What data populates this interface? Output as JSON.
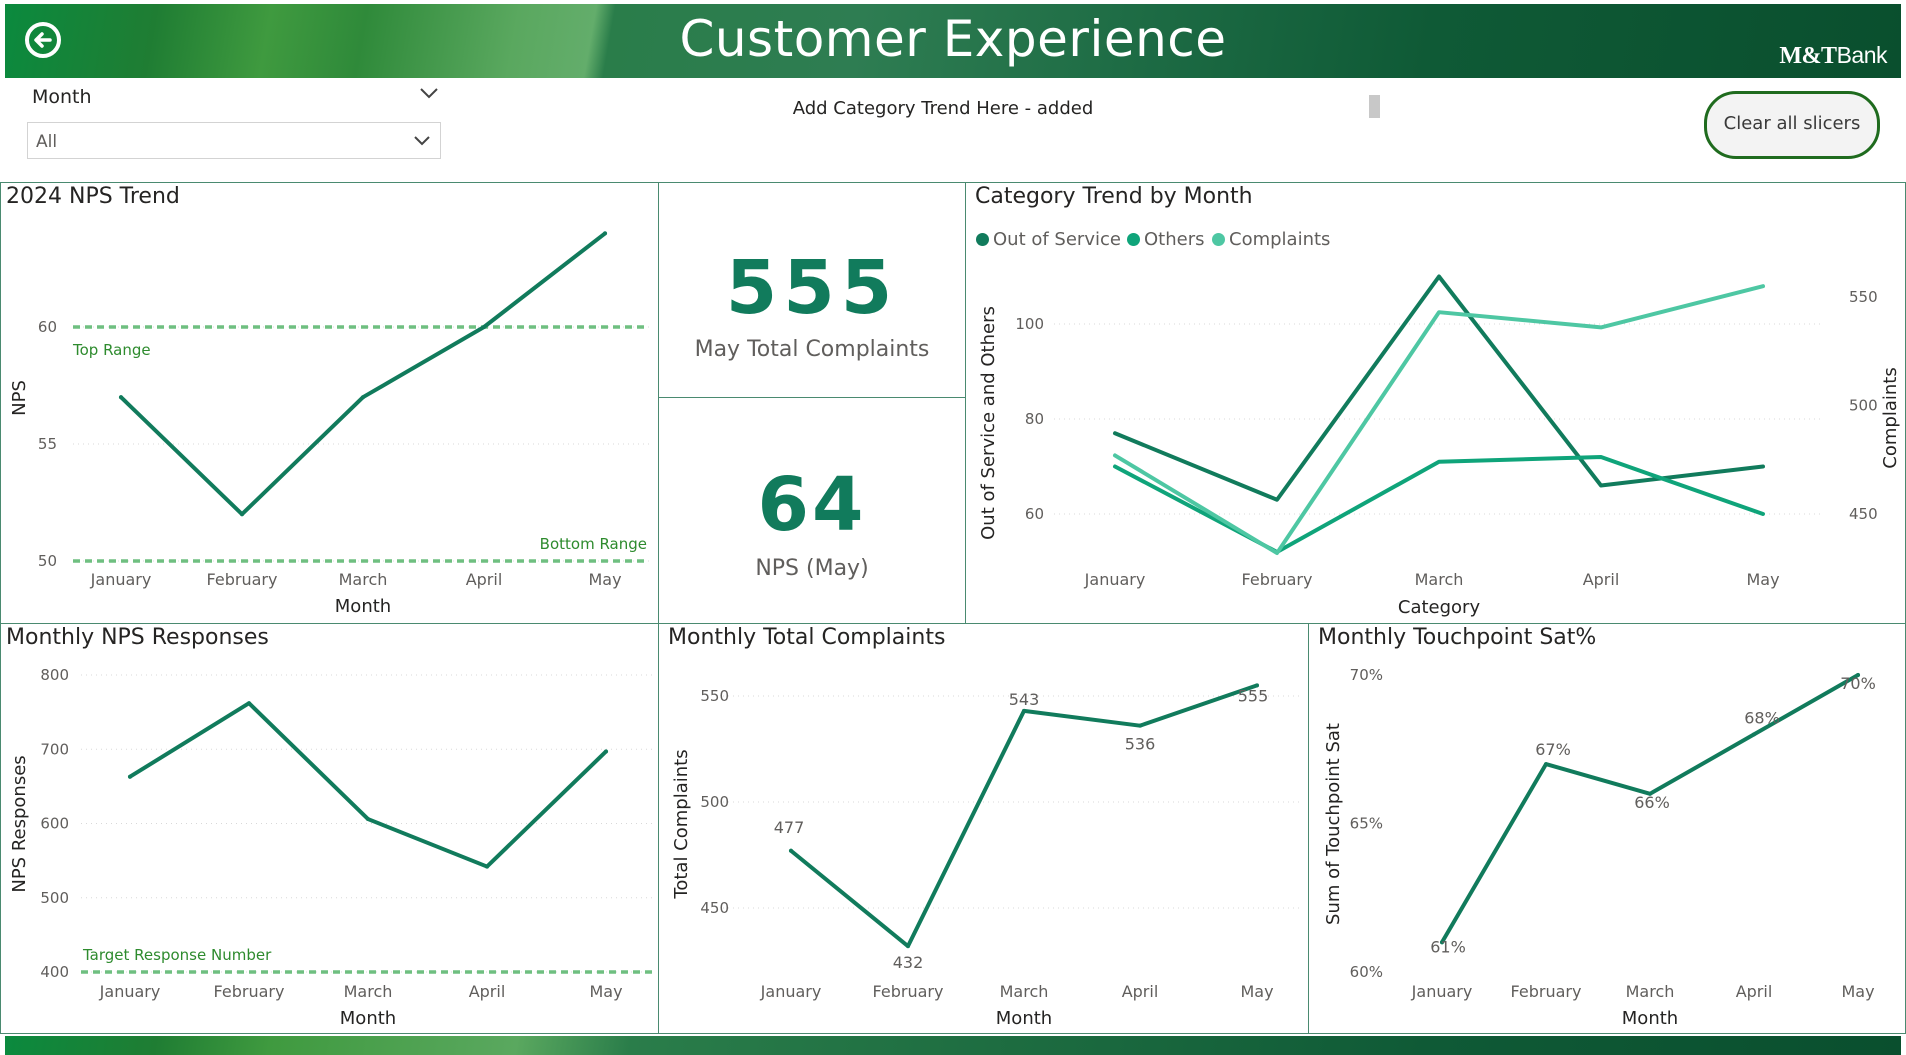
{
  "header": {
    "title": "Customer Experience",
    "logo_text": "M&T",
    "logo_bank": "Bank",
    "back_icon": "back-arrow-icon"
  },
  "slicer": {
    "title": "Month",
    "value": "All"
  },
  "category_note": "Add Category Trend Here - added",
  "clear_button": "Clear all slicers",
  "kpis": {
    "complaints_value": "555",
    "complaints_label": "May Total Complaints",
    "nps_value": "64",
    "nps_label": "NPS (May)"
  },
  "colors": {
    "series_main": "#117b5c",
    "others": "#0fa47a",
    "complaints": "#4ec7a3",
    "reference_line": "#6fbf80",
    "reference_text": "#2e8b2e"
  },
  "nps_trend": {
    "title": "2024 NPS Trend",
    "chart_data": {
      "type": "line",
      "categories": [
        "January",
        "February",
        "March",
        "April",
        "May"
      ],
      "values": [
        57,
        52,
        57,
        60,
        64
      ],
      "xlabel": "Month",
      "ylabel": "NPS",
      "yticks": [
        "50",
        "55",
        "60"
      ],
      "ylim": [
        50,
        64
      ],
      "reference_lines": [
        {
          "label": "Top Range",
          "value": 60
        },
        {
          "label": "Bottom Range",
          "value": 50
        }
      ]
    }
  },
  "category_trend": {
    "title": "Category Trend by Month",
    "legend": [
      "Out of Service",
      "Others",
      "Complaints"
    ],
    "chart_data": {
      "type": "line",
      "categories": [
        "January",
        "February",
        "March",
        "April",
        "May"
      ],
      "series": [
        {
          "name": "Out of Service",
          "values": [
            77,
            63,
            110,
            66,
            70
          ],
          "axis": "left"
        },
        {
          "name": "Others",
          "values": [
            70,
            52,
            71,
            72,
            60
          ],
          "axis": "left"
        },
        {
          "name": "Complaints",
          "values": [
            477,
            432,
            543,
            536,
            555
          ],
          "axis": "right"
        }
      ],
      "xlabel": "Category",
      "ylabel_left": "Out of Service and Others",
      "ylabel_right": "Complaints",
      "yticks_left": [
        "60",
        "80",
        "100"
      ],
      "yticks_right": [
        "450",
        "500",
        "550"
      ]
    }
  },
  "nps_responses": {
    "title": "Monthly NPS Responses",
    "chart_data": {
      "type": "line",
      "categories": [
        "January",
        "February",
        "March",
        "April",
        "May"
      ],
      "values": [
        663,
        762,
        606,
        542,
        697
      ],
      "xlabel": "Month",
      "ylabel": "NPS Responses",
      "yticks": [
        "400",
        "500",
        "600",
        "700",
        "800"
      ],
      "ylim": [
        400,
        800
      ],
      "reference_lines": [
        {
          "label": "Target Response Number",
          "value": 400
        }
      ]
    }
  },
  "total_complaints": {
    "title": "Monthly Total Complaints",
    "chart_data": {
      "type": "line",
      "categories": [
        "January",
        "February",
        "March",
        "April",
        "May"
      ],
      "values": [
        477,
        432,
        543,
        536,
        555
      ],
      "data_labels": [
        "477",
        "432",
        "543",
        "536",
        "555"
      ],
      "xlabel": "Month",
      "ylabel": "Total Complaints",
      "yticks": [
        "450",
        "500",
        "550"
      ]
    }
  },
  "touchpoint": {
    "title": "Monthly Touchpoint Sat%",
    "chart_data": {
      "type": "line",
      "categories": [
        "January",
        "February",
        "March",
        "April",
        "May"
      ],
      "values": [
        61,
        67,
        66,
        68,
        70
      ],
      "data_labels": [
        "61%",
        "67%",
        "66%",
        "68%",
        "70%"
      ],
      "xlabel": "Month",
      "ylabel": "Sum of Touchpoint Sat",
      "yticks": [
        "60%",
        "65%",
        "70%"
      ],
      "ylim": [
        60,
        70
      ]
    }
  }
}
